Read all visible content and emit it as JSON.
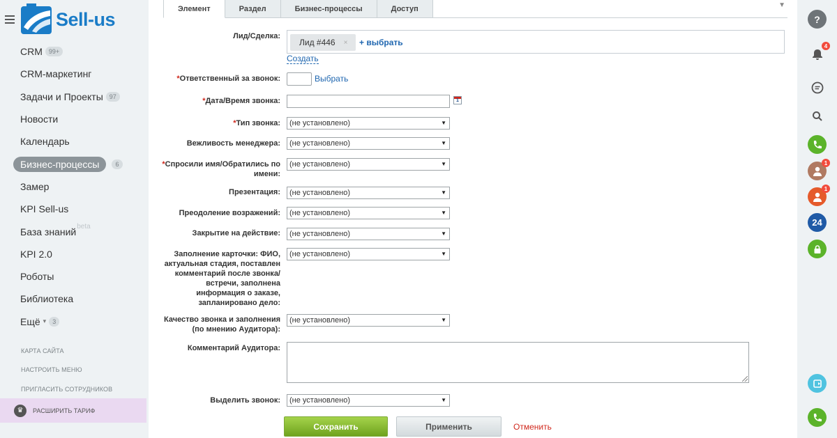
{
  "sidebar": {
    "logo_text": "Sell-us",
    "menu": [
      {
        "label": "CRM",
        "count": "99+"
      },
      {
        "label": "CRM-маркетинг",
        "count": ""
      },
      {
        "label": "Задачи и Проекты",
        "count": "97"
      },
      {
        "label": "Новости",
        "count": ""
      },
      {
        "label": "Календарь",
        "count": ""
      },
      {
        "label": "Бизнес-процессы",
        "count": "6"
      },
      {
        "label": "Замер",
        "count": ""
      },
      {
        "label": "KPI Sell-us",
        "count": ""
      },
      {
        "label": "База знаний",
        "count": "",
        "beta": "beta"
      },
      {
        "label": "KPI 2.0",
        "count": ""
      },
      {
        "label": "Роботы",
        "count": ""
      },
      {
        "label": "Библиотека",
        "count": ""
      },
      {
        "label": "Ещё",
        "count": "3",
        "arrow": "▾"
      }
    ],
    "sub_menu": [
      "КАРТА САЙТА",
      "НАСТРОИТЬ МЕНЮ",
      "ПРИГЛАСИТЬ СОТРУДНИКОВ"
    ],
    "upgrade_label": "РАСШИРИТЬ ТАРИФ"
  },
  "tabs": [
    "Элемент",
    "Раздел",
    "Бизнес-процессы",
    "Доступ"
  ],
  "form": {
    "lead_label": "Лид/Сделка:",
    "lead_chip": "Лид #446",
    "lead_remove": "×",
    "lead_choose": "+ выбрать",
    "lead_create": "Создать",
    "responsible_label": "Ответственный за звонок:",
    "responsible_link": "Выбрать",
    "datetime_label": "Дата/Время звонка:",
    "required_mark": "*",
    "not_set": "(не установлено)",
    "call_type_label": "Тип звонка:",
    "politeness_label": "Вежливость менеджера:",
    "asked_name_label": "Спросили имя/Обратились по имени:",
    "presentation_label": "Презентация:",
    "objections_label": "Преодоление возражений:",
    "closing_label": "Закрытие на действие:",
    "card_label": "Заполнение карточки: ФИО, актуальная стадия, поставлен комментарий после звонка/встречи, заполнена информация о заказе, запланировано дело:",
    "quality_label": "Качество звонка и заполнения (по мнению Аудитора):",
    "auditor_comment_label": "Комментарий Аудитора:",
    "highlight_label": "Выделить звонок:",
    "save": "Сохранить",
    "apply": "Применить",
    "cancel": "Отменить"
  },
  "rightbar": {
    "icons": [
      "help-icon",
      "notifications-icon",
      "chat-icon",
      "search-icon",
      "phone-icon",
      "user-avatar-icon",
      "user-avatar-icon",
      "bitrix24-icon",
      "lock-icon",
      "contact-center-icon",
      "phone-icon"
    ],
    "notifications_badge": "4",
    "avatar1_badge": "1",
    "avatar2_badge": "1",
    "b24_label": "24"
  },
  "colors": {
    "brand": "#1a7cc7",
    "link": "#2067b0",
    "required": "#d0281d",
    "save_button": "#7bb32e",
    "phone_green": "#5bb32a"
  }
}
